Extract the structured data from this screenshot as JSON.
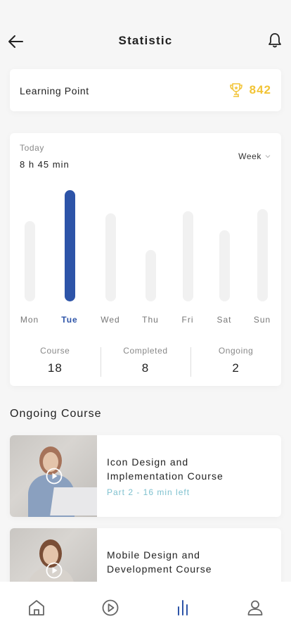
{
  "header": {
    "title": "Statistic",
    "back_icon": "arrow-left-icon",
    "notification_icon": "bell-icon"
  },
  "learning_point": {
    "label": "Learning Point",
    "value": "842",
    "icon": "trophy-icon",
    "accent_color": "#f2c436"
  },
  "stats": {
    "today_label": "Today",
    "today_value": "8 h 45 min",
    "period_label": "Week",
    "accent_color": "#2d54a8"
  },
  "chart_data": {
    "type": "bar",
    "categories": [
      "Mon",
      "Tue",
      "Wed",
      "Thu",
      "Fri",
      "Sat",
      "Sun"
    ],
    "values": [
      0.72,
      1.0,
      0.79,
      0.46,
      0.81,
      0.64,
      0.83
    ],
    "highlighted": "Tue",
    "ylim": [
      0,
      1
    ],
    "grid": false,
    "title": "",
    "xlabel": "",
    "ylabel": ""
  },
  "summary": [
    {
      "label": "Course",
      "value": "18"
    },
    {
      "label": "Completed",
      "value": "8"
    },
    {
      "label": "Ongoing",
      "value": "2"
    }
  ],
  "ongoing": {
    "title": "Ongoing Course",
    "courses": [
      {
        "title": "Icon Design and Implementation Course",
        "subtitle": "Part 2 - 16 min left"
      },
      {
        "title": "Mobile Design and Development Course",
        "subtitle": ""
      }
    ]
  },
  "bottom_nav": {
    "items": [
      {
        "icon": "home-icon",
        "active": false
      },
      {
        "icon": "play-circle-icon",
        "active": false
      },
      {
        "icon": "bar-chart-icon",
        "active": true
      },
      {
        "icon": "profile-icon",
        "active": false
      }
    ]
  }
}
